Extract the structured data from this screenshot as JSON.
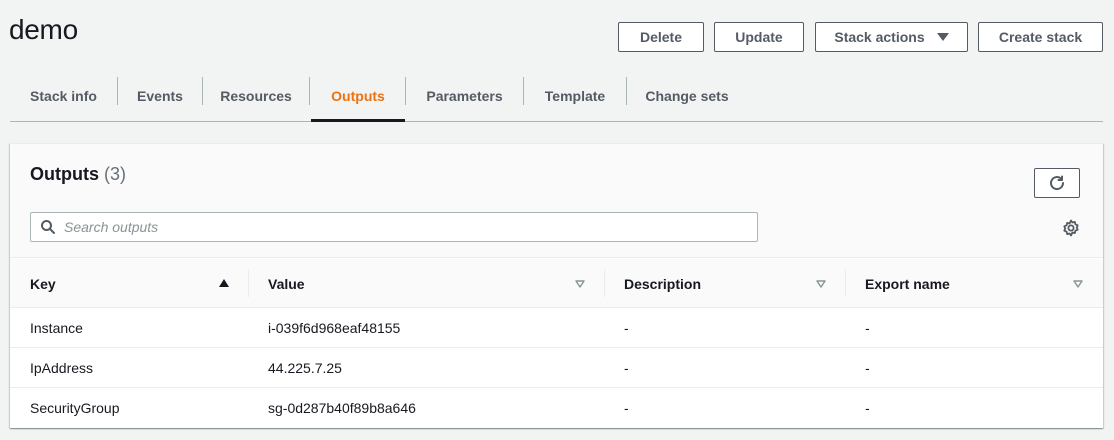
{
  "page": {
    "title": "demo"
  },
  "actions": {
    "delete": "Delete",
    "update": "Update",
    "stack_actions": "Stack actions",
    "create_stack": "Create stack"
  },
  "tabs": [
    {
      "label": "Stack info",
      "active": false
    },
    {
      "label": "Events",
      "active": false
    },
    {
      "label": "Resources",
      "active": false
    },
    {
      "label": "Outputs",
      "active": true
    },
    {
      "label": "Parameters",
      "active": false
    },
    {
      "label": "Template",
      "active": false
    },
    {
      "label": "Change sets",
      "active": false
    }
  ],
  "outputs": {
    "title": "Outputs",
    "count": "(3)",
    "search_placeholder": "Search outputs",
    "columns": [
      "Key",
      "Value",
      "Description",
      "Export name"
    ],
    "sort": {
      "column": "Key",
      "direction": "ascending"
    },
    "rows": [
      {
        "key": "Instance",
        "value": "i-039f6d968eaf48155",
        "description": "-",
        "export_name": "-"
      },
      {
        "key": "IpAddress",
        "value": "44.225.7.25",
        "description": "-",
        "export_name": "-"
      },
      {
        "key": "SecurityGroup",
        "value": "sg-0d287b40f89b8a646",
        "description": "-",
        "export_name": "-"
      }
    ]
  },
  "icons": {
    "refresh": "refresh-icon",
    "search": "search-icon",
    "settings": "gear-icon",
    "sort_asc": "caret-up-icon",
    "sort_none": "caret-down-outline-icon",
    "dropdown": "caret-down-icon"
  },
  "colors": {
    "accent": "#ec7211",
    "text": "#16191f",
    "secondary_text": "#545b64",
    "background": "#f2f3f3"
  }
}
